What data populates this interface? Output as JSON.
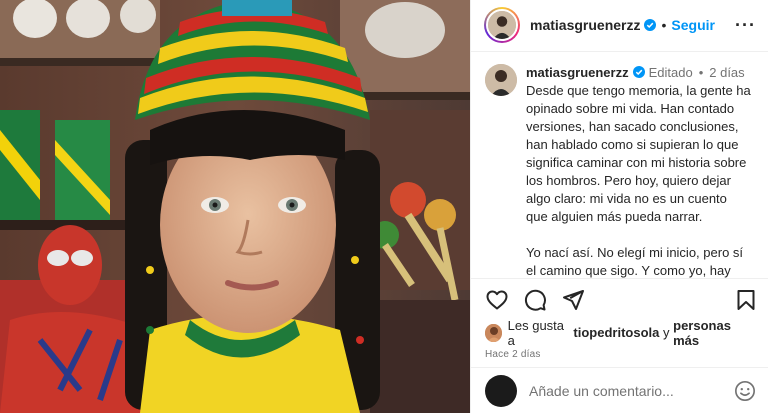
{
  "post": {
    "username": "matiasgruenerzz",
    "follow_label": "Seguir",
    "separator": "•",
    "more_label": "···",
    "caption": {
      "edited_label": "Editado",
      "separator": "•",
      "time": "2 días",
      "paragraph_1": "Desde que tengo memoria, la gente ha opinado sobre mi vida. Han contado versiones, han sacado conclusiones, han hablado como si supieran lo que significa caminar con mi historia sobre los hombros. Pero hoy, quiero dejar algo claro: mi vida no es un cuento que alguien más pueda narrar.",
      "paragraph_2": "Yo nací así. No elegí mi inicio, pero sí el camino que sigo. Y como yo, hay"
    },
    "likes": {
      "prefix": "Les gusta a",
      "user": "tiopedritosola",
      "conjunction": "y",
      "suffix": "personas más"
    },
    "posted_ago": "Hace 2 días",
    "comment_placeholder": "Añade un comentario...",
    "icons": {
      "like": "heart-icon",
      "comment": "comment-icon",
      "share": "share-icon",
      "save": "bookmark-icon",
      "verified": "verified-badge-icon",
      "emoji": "emoji-icon"
    },
    "colors": {
      "accent": "#0095f6",
      "text": "#262626",
      "muted": "#737373",
      "border": "#efefef"
    }
  }
}
